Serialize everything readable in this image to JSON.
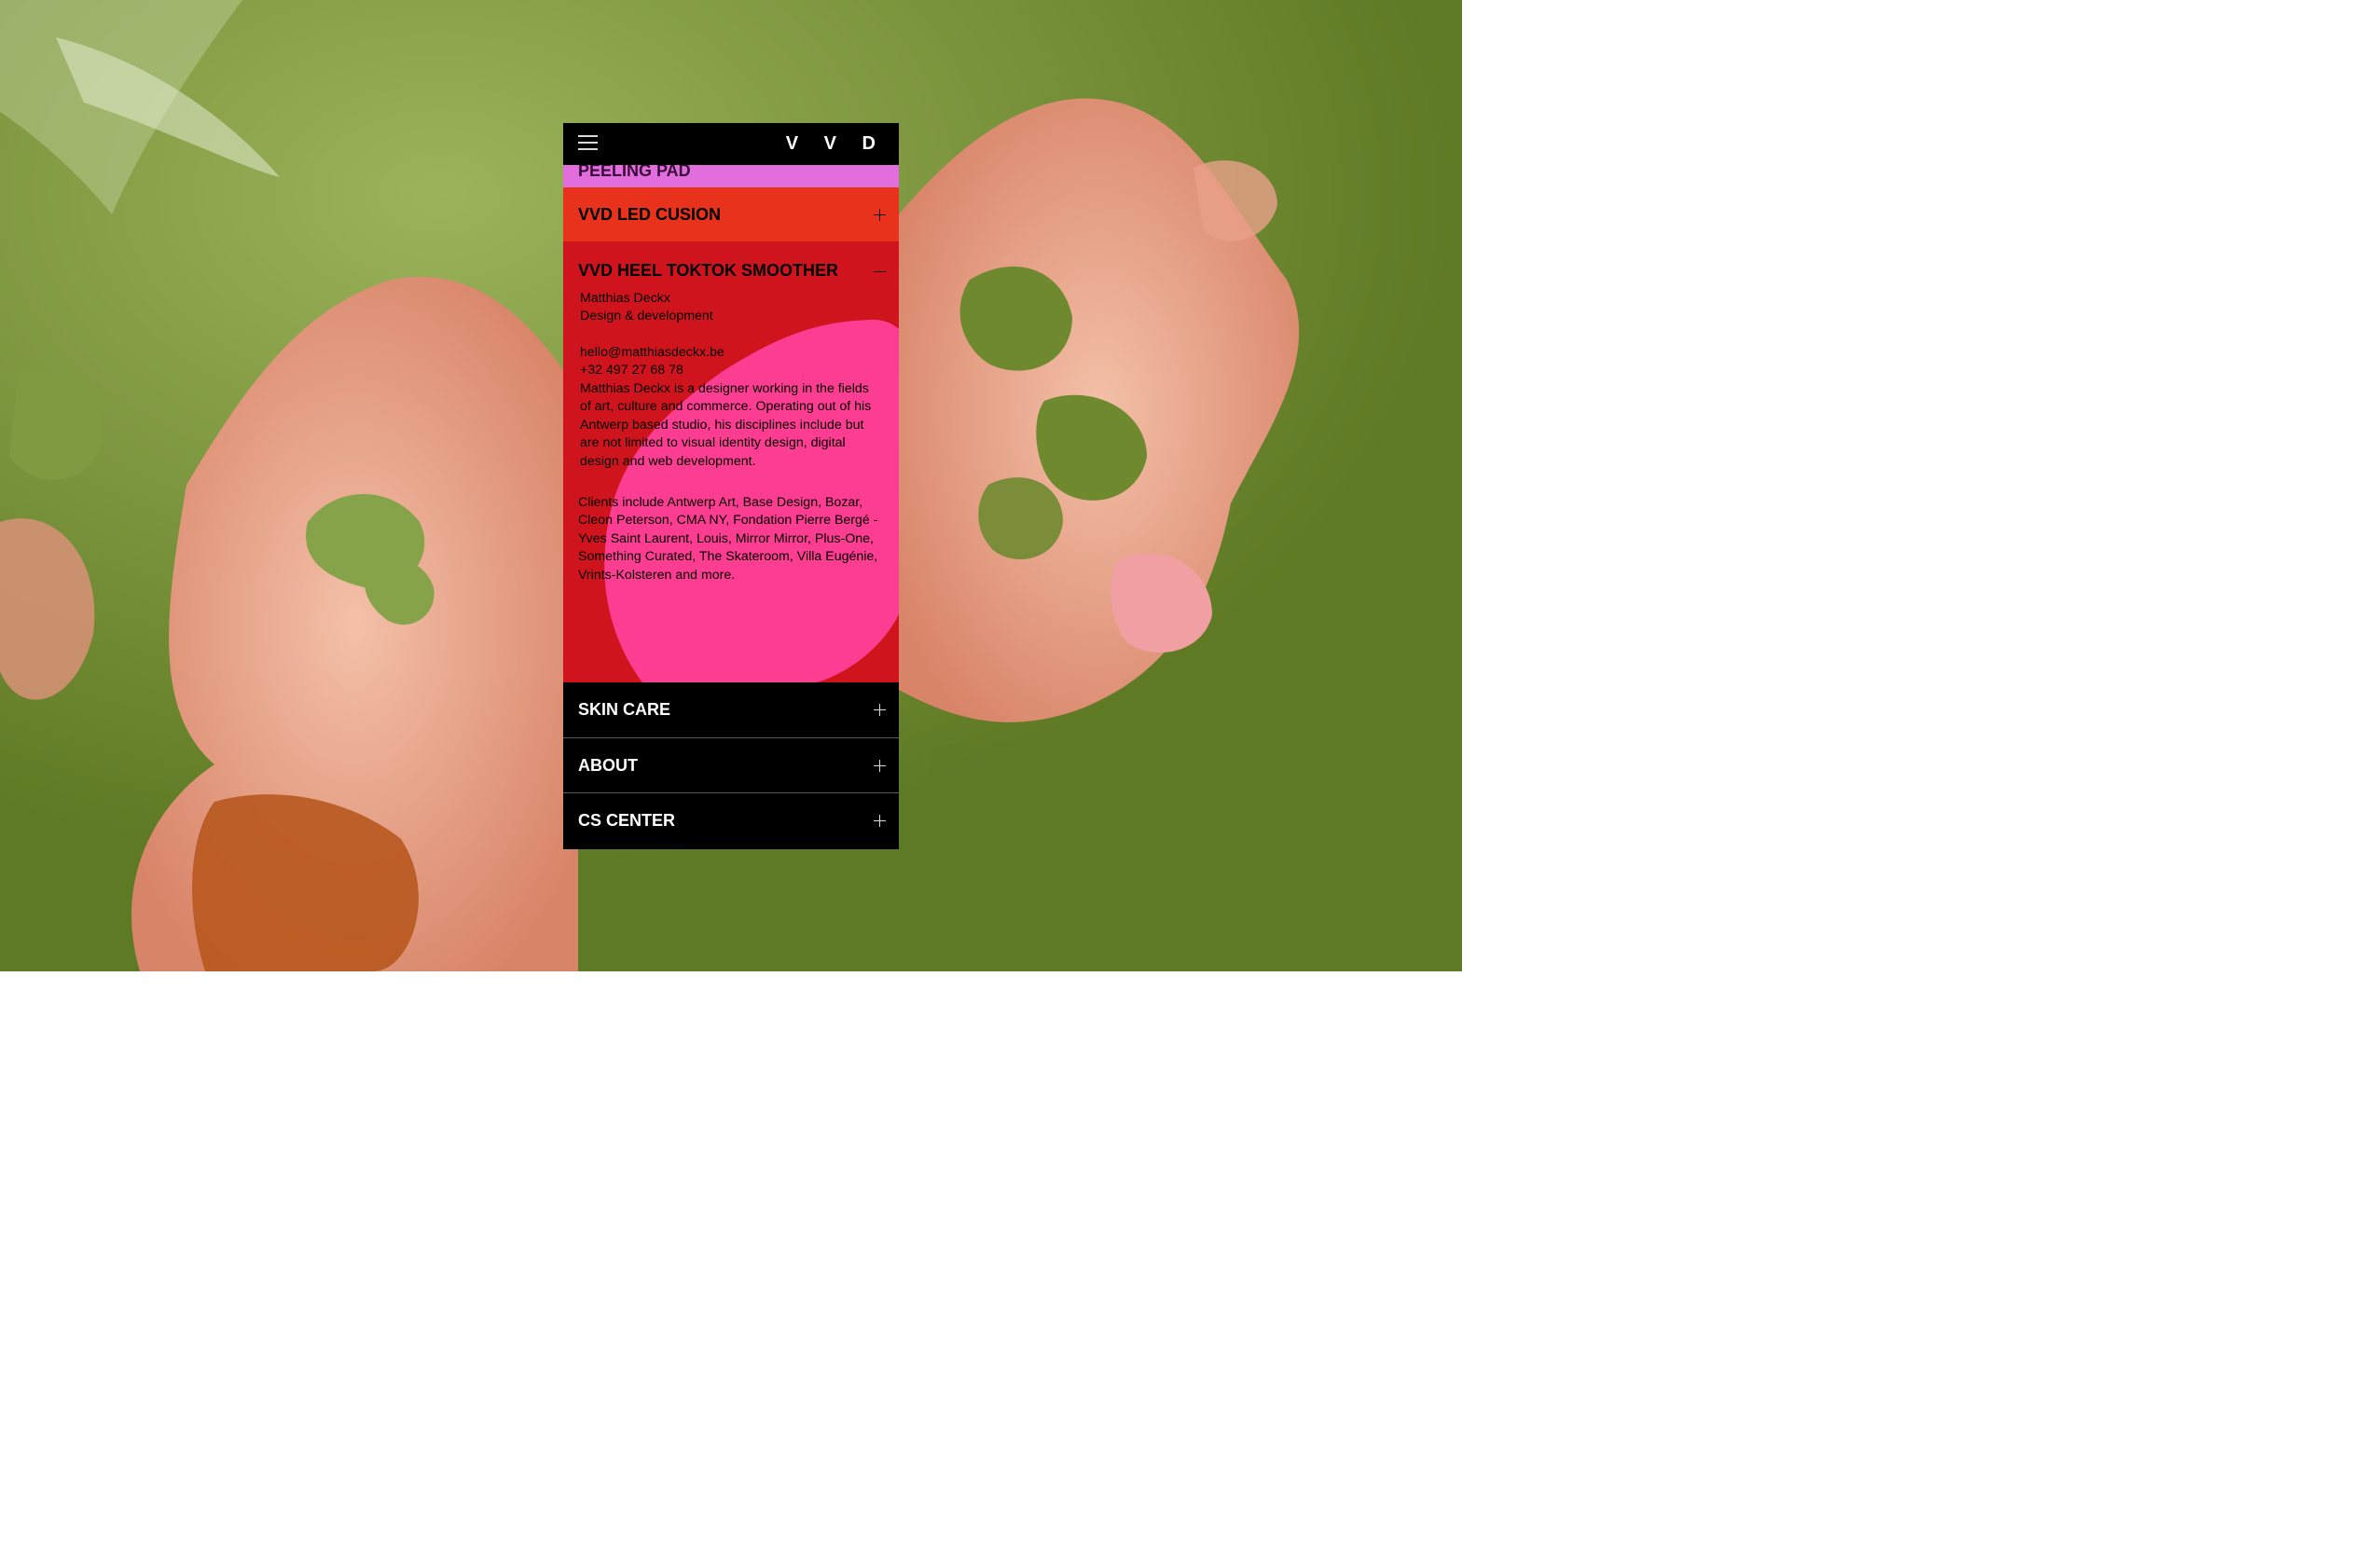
{
  "logo": "V V D",
  "colors": {
    "peeling_bg": "#e26ede",
    "led_bg": "#e8321c",
    "expanded_bg": "#cf141d",
    "blob": "#fd3d91",
    "dark_bg": "#000000",
    "background_green": "#6f8a2e",
    "background_pink": "#e9a88f"
  },
  "icons": {
    "menu": "hamburger-icon",
    "expand": "plus-icon",
    "collapse": "minus-icon"
  },
  "menu": {
    "peeling": "PEELING PAD",
    "led": "VVD LED CUSION",
    "heel": "VVD HEEL TOKTOK SMOOTHER",
    "skin": "SKIN CARE",
    "about": "ABOUT",
    "cs": "CS CENTER"
  },
  "info": {
    "name": "Matthias Deckx",
    "role": "Design & development",
    "email": "hello@matthiasdeckx.be",
    "phone": "+32 497 27 68 78",
    "bio": "Matthias Deckx is a designer working in the fields of art, culture and commerce. Operating out of his Antwerp based studio, his disciplines include but are not limited to visual identity design, digital design and web development.",
    "clients": "Clients include Antwerp Art, Base Design, Bozar, Cleon Peterson, CMA NY, Fondation Pierre Bergé - Yves Saint Laurent, Louis, Mirror Mirror, Plus-One, Something Curated, The Skateroom, Villa Eugénie, Vrints-Kolsteren and more."
  }
}
